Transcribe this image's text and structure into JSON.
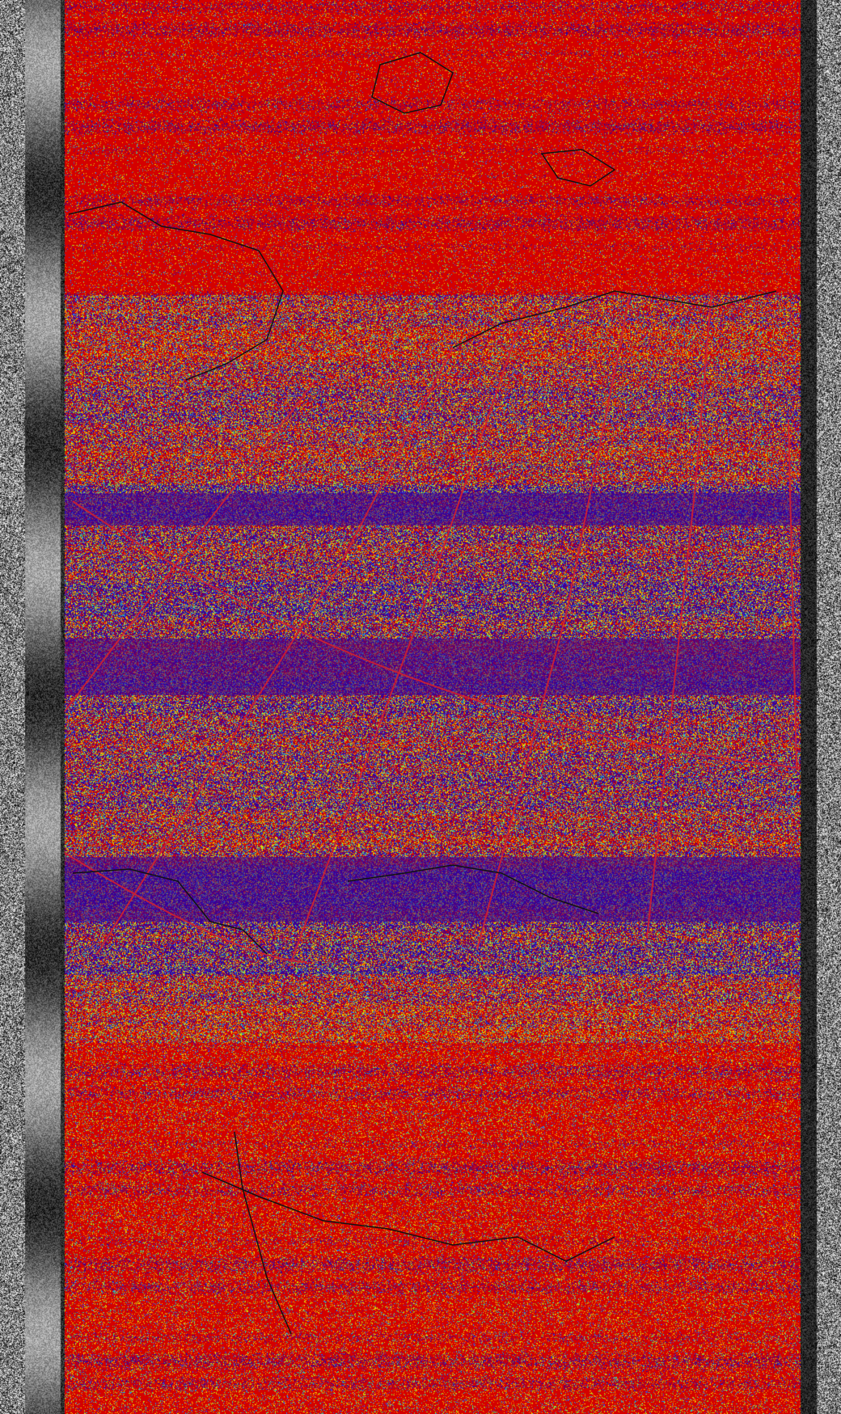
{
  "image": {
    "kind": "false-color satellite weather image (NOAA APT style)",
    "palette": {
      "background_noise_dark": "#111111",
      "background_noise_light": "#e0e0e0",
      "warm_field": "#d40000",
      "cold_band": "#3a0096",
      "speckle_colors": [
        "#ffd400",
        "#7fdc2a",
        "#1ec8c8",
        "#2a55ff",
        "#ff7a00",
        "#e0e000"
      ],
      "grid_line": "#d02030",
      "coastline": "#111111"
    },
    "layout_bands": [
      {
        "name": "top-warm",
        "color": "warm_field"
      },
      {
        "name": "upper-cold-mixed",
        "color": "cold_band"
      },
      {
        "name": "middle-cold",
        "color": "cold_band"
      },
      {
        "name": "lower-cold",
        "color": "cold_band"
      },
      {
        "name": "bottom-warm",
        "color": "warm_field"
      }
    ]
  }
}
